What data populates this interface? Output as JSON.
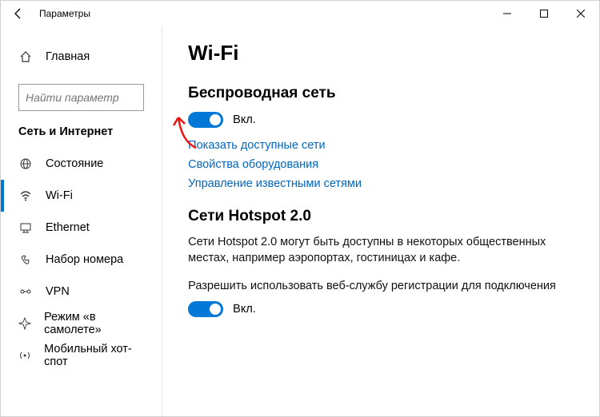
{
  "window": {
    "title": "Параметры"
  },
  "sidebar": {
    "home": "Главная",
    "search_placeholder": "Найти параметр",
    "category": "Сеть и Интернет",
    "items": [
      {
        "label": "Состояние"
      },
      {
        "label": "Wi-Fi"
      },
      {
        "label": "Ethernet"
      },
      {
        "label": "Набор номера"
      },
      {
        "label": "VPN"
      },
      {
        "label": "Режим «в самолете»"
      },
      {
        "label": "Мобильный хот-спот"
      }
    ]
  },
  "main": {
    "heading": "Wi-Fi",
    "section_wifi": "Беспроводная сеть",
    "toggle_wifi_label": "Вкл.",
    "link_show_networks": "Показать доступные сети",
    "link_hw_props": "Свойства оборудования",
    "link_known_nets": "Управление известными сетями",
    "section_hotspot": "Сети Hotspot 2.0",
    "hotspot_desc": "Сети Hotspot 2.0 могут быть доступны в некоторых общественных местах, например аэропортах, гостиницах и кафе.",
    "hotspot_allow": "Разрешить использовать веб-службу регистрации для подключения",
    "toggle_hotspot_label": "Вкл."
  }
}
